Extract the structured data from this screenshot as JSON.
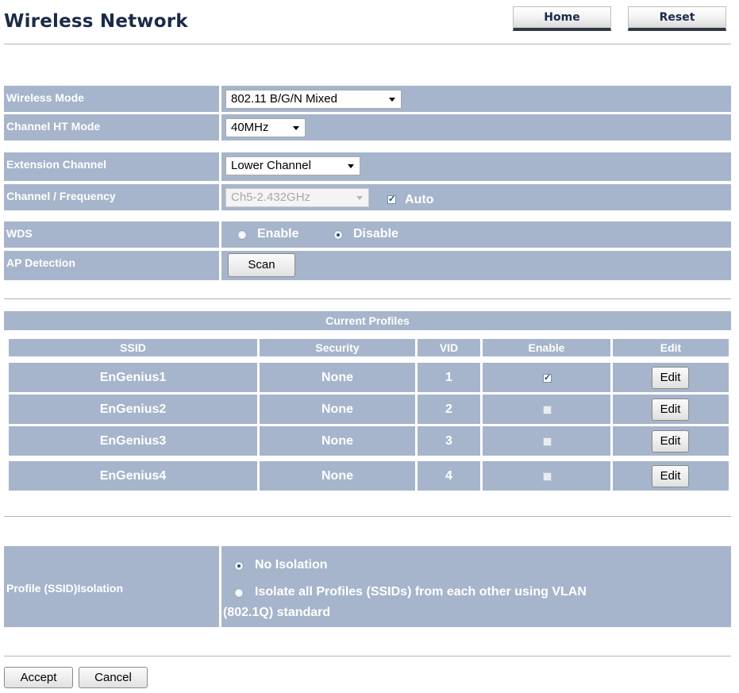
{
  "page": {
    "title": "Wireless Network",
    "home_label": "Home",
    "reset_label": "Reset"
  },
  "settings": {
    "wireless_mode": {
      "label": "Wireless Mode",
      "value": "802.11 B/G/N Mixed"
    },
    "channel_ht_mode": {
      "label": "Channel HT Mode",
      "value": "40MHz"
    },
    "extension_channel": {
      "label": "Extension Channel",
      "value": "Lower Channel"
    },
    "channel_frequency": {
      "label": "Channel / Frequency",
      "value": "Ch5-2.432GHz",
      "auto_label": "Auto",
      "auto_checked": true
    },
    "wds": {
      "label": "WDS",
      "enable_label": "Enable",
      "disable_label": "Disable",
      "selected": "Disable"
    },
    "ap_detection": {
      "label": "AP Detection",
      "scan_label": "Scan"
    }
  },
  "profiles": {
    "heading": "Current Profiles",
    "columns": [
      "SSID",
      "Security",
      "VID",
      "Enable",
      "Edit"
    ],
    "rows": [
      {
        "ssid": "EnGenius1",
        "security": "None",
        "vid": "1",
        "enabled": true,
        "edit_label": "Edit"
      },
      {
        "ssid": "EnGenius2",
        "security": "None",
        "vid": "2",
        "enabled": false,
        "edit_label": "Edit"
      },
      {
        "ssid": "EnGenius3",
        "security": "None",
        "vid": "3",
        "enabled": false,
        "edit_label": "Edit"
      },
      {
        "ssid": "EnGenius4",
        "security": "None",
        "vid": "4",
        "enabled": false,
        "edit_label": "Edit"
      }
    ]
  },
  "isolation": {
    "label": "Profile (SSID)Isolation",
    "option_none": "No Isolation",
    "option_vlan_line1": "Isolate all Profiles (SSIDs) from each other using VLAN",
    "option_vlan_line2": "(802.1Q) standard",
    "selected": "No Isolation"
  },
  "footer": {
    "accept_label": "Accept",
    "cancel_label": "Cancel"
  }
}
